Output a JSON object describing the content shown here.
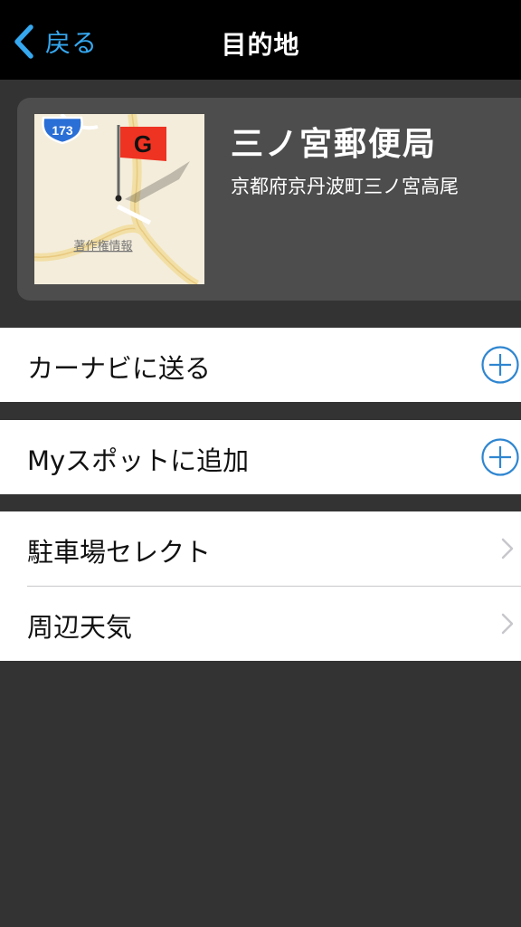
{
  "nav": {
    "back_label": "戻る",
    "title": "目的地"
  },
  "destination": {
    "name": "三ノ宮郵便局",
    "address": "京都府京丹波町三ノ宮高尾",
    "map": {
      "route_number": "173",
      "flag_letter": "G",
      "copyright_label": "著作権情報"
    }
  },
  "actions": [
    {
      "label": "カーナビに送る",
      "icon": "plus-circle-icon"
    },
    {
      "label": "Myスポットに追加",
      "icon": "plus-circle-icon"
    }
  ],
  "menu": [
    {
      "label": "駐車場セレクト",
      "icon": "chevron-right-icon"
    },
    {
      "label": "周辺天気",
      "icon": "chevron-right-icon"
    }
  ],
  "colors": {
    "accent": "#35a8f0",
    "action_icon": "#2f86d0",
    "nav_background": "#000000",
    "page_background": "#333333",
    "card_background": "#4d4d4d",
    "flag": "#ee3322"
  }
}
